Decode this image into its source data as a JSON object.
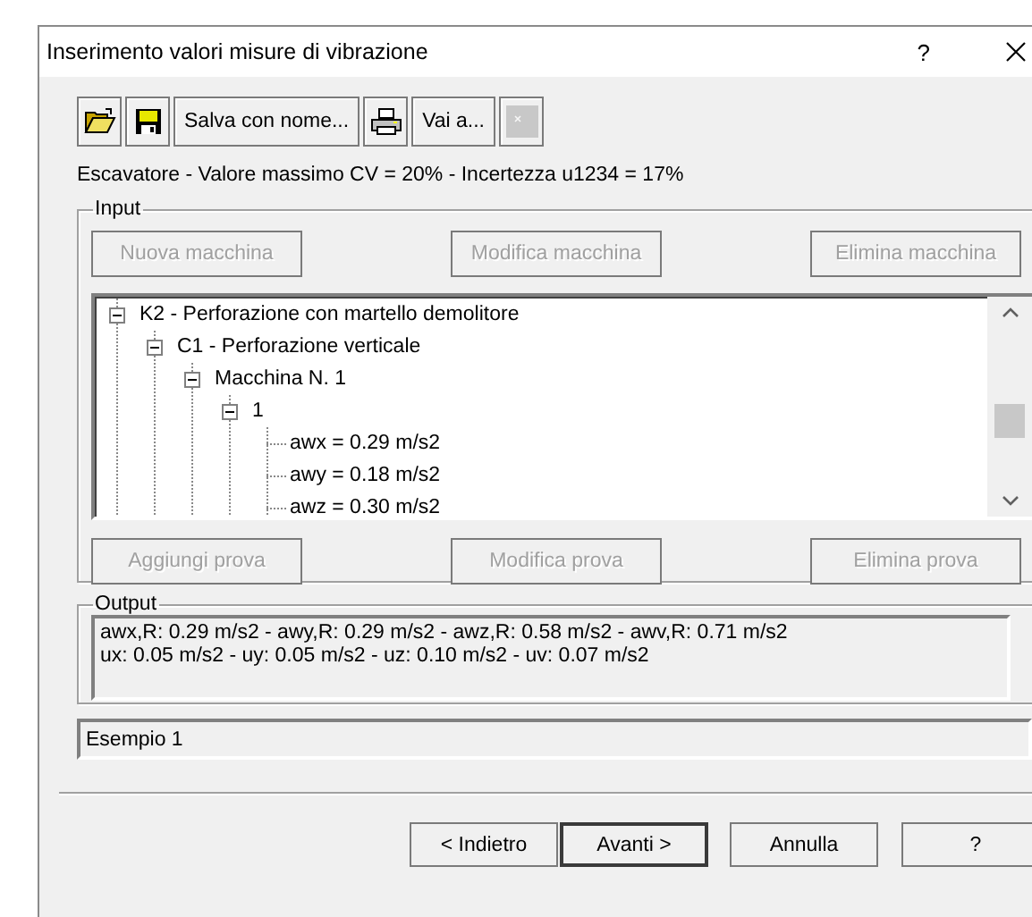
{
  "window": {
    "title": "Inserimento valori misure di vibrazione",
    "help": "?"
  },
  "toolbar": [
    {
      "kind": "open",
      "disabled": false
    },
    {
      "kind": "save",
      "disabled": false
    },
    {
      "kind": "text",
      "label": "Salva con nome...",
      "disabled": false
    },
    {
      "kind": "print",
      "disabled": false
    },
    {
      "kind": "text",
      "label": "Vai a...",
      "disabled": false
    },
    {
      "kind": "blank",
      "disabled": true
    }
  ],
  "info": "Escavatore - Valore massimo CV = 20% - Incertezza u1234 = 17%",
  "input": {
    "label": "Input",
    "machine_buttons": [
      {
        "label": "Nuova macchina",
        "disabled": true
      },
      {
        "label": "Modifica macchina",
        "disabled": true
      },
      {
        "label": "Elimina macchina",
        "disabled": true
      }
    ],
    "tree": [
      {
        "label": "K2 - Perforazione con martello demolitore",
        "expanded": true,
        "children": [
          {
            "label": "C1 - Perforazione verticale",
            "expanded": true,
            "children": [
              {
                "label": "Macchina N. 1",
                "expanded": true,
                "children": [
                  {
                    "label": "1",
                    "expanded": true,
                    "children": [
                      {
                        "label": "awx = 0.29 m/s2"
                      },
                      {
                        "label": "awy = 0.18 m/s2"
                      },
                      {
                        "label": "awz = 0.30 m/s2"
                      }
                    ]
                  }
                ]
              }
            ]
          }
        ]
      }
    ],
    "test_buttons": [
      {
        "label": "Aggiungi prova",
        "disabled": true
      },
      {
        "label": "Modifica prova",
        "disabled": true
      },
      {
        "label": "Elimina prova",
        "disabled": true
      }
    ]
  },
  "output": {
    "label": "Output",
    "lines": [
      "awx,R: 0.29 m/s2 - awy,R: 0.29 m/s2 - awz,R: 0.58 m/s2 - awv,R: 0.71 m/s2",
      "ux: 0.05 m/s2 - uy: 0.05 m/s2 - uz: 0.10 m/s2 - uv: 0.07 m/s2"
    ]
  },
  "name_field": {
    "value": "Esempio 1"
  },
  "buttons": [
    {
      "label": "< Indietro",
      "default": false
    },
    {
      "label": "Avanti >",
      "default": true
    },
    {
      "label": "Annulla",
      "default": false
    },
    {
      "label": "?",
      "default": false
    }
  ]
}
